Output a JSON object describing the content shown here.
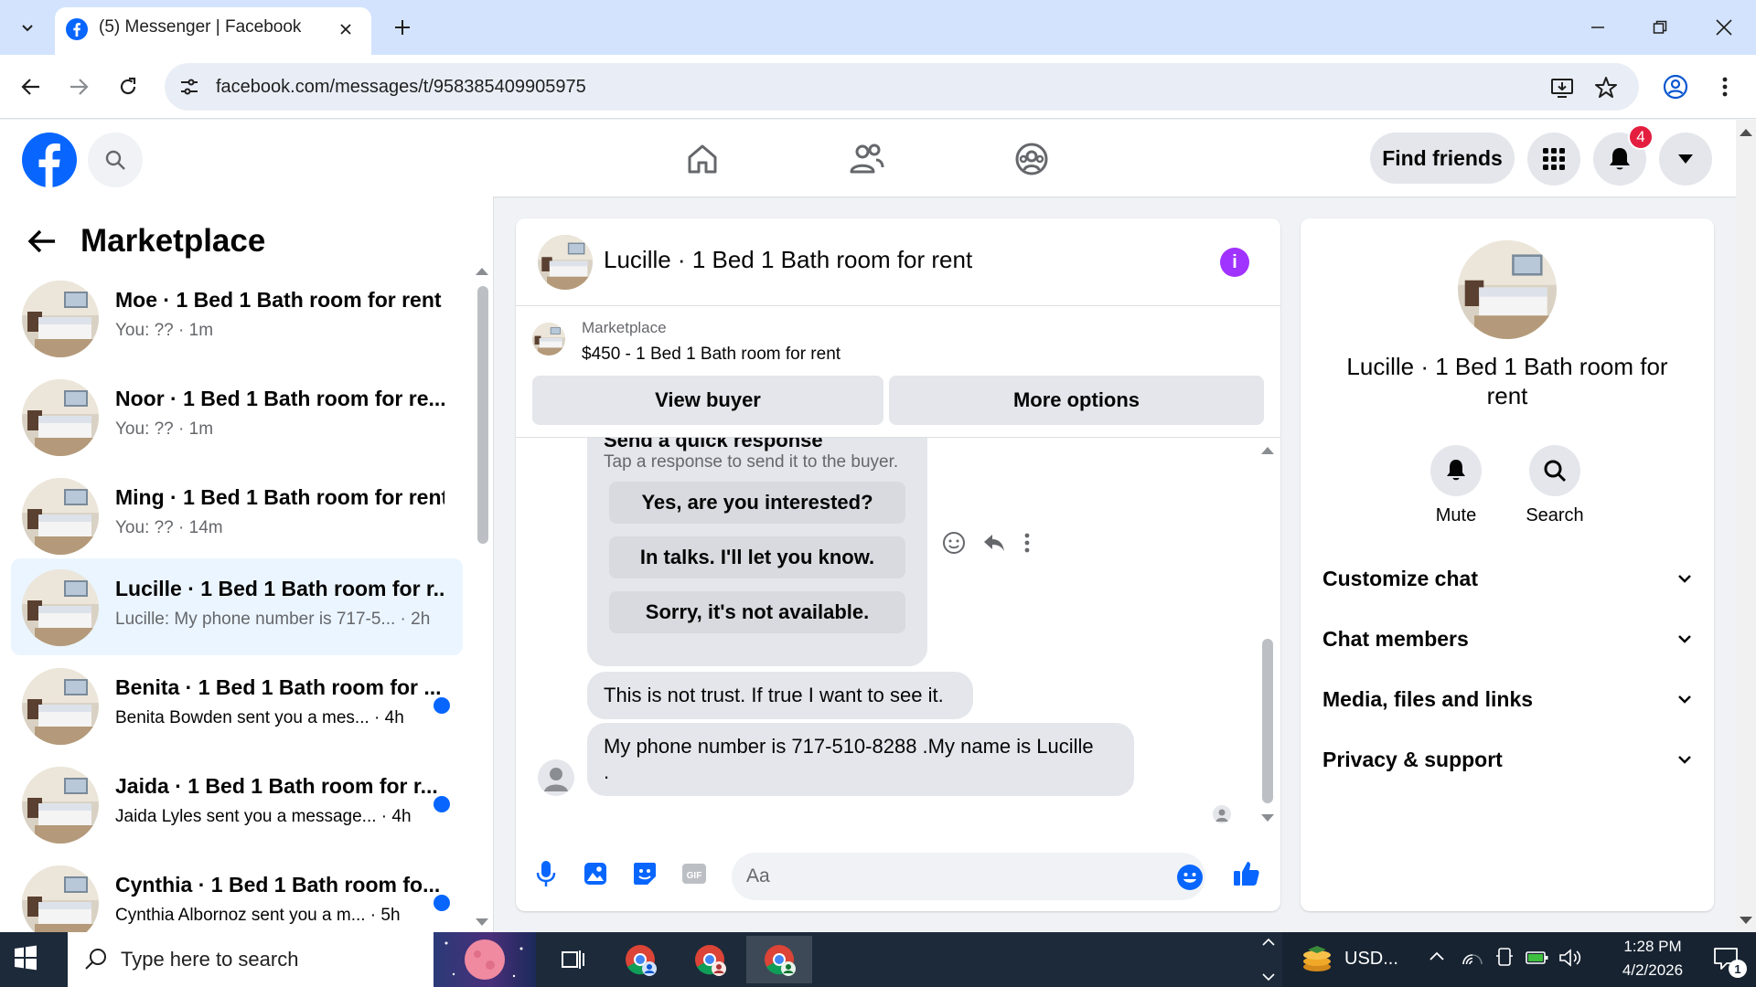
{
  "browser": {
    "tab_title": "(5) Messenger | Facebook",
    "url": "facebook.com/messages/t/958385409905975"
  },
  "fbnav": {
    "find_friends": "Find friends",
    "notification_count": "4"
  },
  "left": {
    "title": "Marketplace",
    "conversations": [
      {
        "name": "Moe · 1 Bed 1 Bath room for rent",
        "preview": "You: ?? · 1m",
        "unread": false,
        "active": false
      },
      {
        "name": "Noor · 1 Bed 1 Bath room for re...",
        "preview": "You: ?? · 1m",
        "unread": false,
        "active": false
      },
      {
        "name": "Ming · 1 Bed 1 Bath room for rent",
        "preview": "You: ?? · 14m",
        "unread": false,
        "active": false
      },
      {
        "name": "Lucille · 1 Bed 1 Bath room for r...",
        "preview": "Lucille: My phone number is 717-5... · 2h",
        "unread": false,
        "active": true
      },
      {
        "name": "Benita · 1 Bed 1 Bath room for ...",
        "preview": "Benita Bowden sent you a mes... · 4h",
        "unread": true,
        "active": false
      },
      {
        "name": "Jaida · 1 Bed 1 Bath room for r...",
        "preview": "Jaida Lyles sent you a message... · 4h",
        "unread": true,
        "active": false
      },
      {
        "name": "Cynthia · 1 Bed 1 Bath room fo...",
        "preview": "Cynthia Albornoz sent you a m... · 5h",
        "unread": true,
        "active": false
      }
    ]
  },
  "chat": {
    "title": "Lucille · 1 Bed 1 Bath room for rent",
    "listing_label": "Marketplace",
    "listing_price": "$450 - 1 Bed 1 Bath room for rent",
    "view_buyer": "View buyer",
    "more_options": "More options",
    "quick_title": "Send a quick response",
    "quick_subtitle": "Tap a response to send it to the buyer.",
    "quick_responses": [
      "Yes, are you interested?",
      "In talks. I'll let you know.",
      "Sorry, it's not available."
    ],
    "messages": [
      "This is not trust. If true I want to see it.",
      "My phone number is 717-510-8288 .My name is Lucille\n."
    ],
    "composer_placeholder": "Aa"
  },
  "right": {
    "name": "Lucille · 1 Bed 1 Bath room for rent",
    "mute": "Mute",
    "search": "Search",
    "sections": [
      "Customize chat",
      "Chat members",
      "Media, files and links",
      "Privacy & support"
    ]
  },
  "taskbar": {
    "search_placeholder": "Type here to search",
    "ticker": "USD...",
    "time": "1:28 PM",
    "date": "4/2/2026",
    "notif_count": "1"
  },
  "colors": {
    "fb_blue": "#0866ff",
    "messenger_purple": "#a033ff",
    "unread_dot": "#0866ff",
    "badge_red": "#e41e3f"
  }
}
